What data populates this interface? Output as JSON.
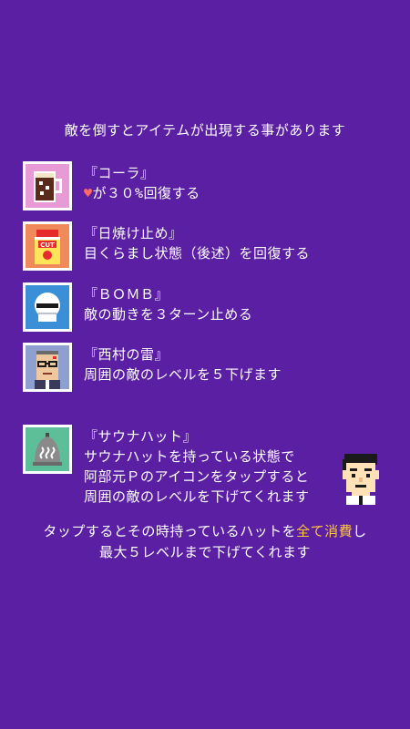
{
  "intro": "敵を倒すとアイテムが出現する事があります",
  "items": [
    {
      "icon": "cola-mug-icon",
      "title": "『コーラ』",
      "desc_prefix": "♥",
      "desc": "が３０%回復する"
    },
    {
      "icon": "sunscreen-bottle-icon",
      "title": "『日焼け止め』",
      "desc": "目くらまし状態（後述）を回復する",
      "label": "CUT"
    },
    {
      "icon": "bomb-icon",
      "title": "『ＢＯＭＢ』",
      "desc": "敵の動きを３ターン止める"
    },
    {
      "icon": "nishimura-face-icon",
      "title": "『西村の雷』",
      "desc": "周囲の敵のレベルを５下げます"
    },
    {
      "icon": "sauna-hat-icon",
      "title": "『サウナハット』",
      "desc1": "サウナハットを持っている状態で",
      "desc2": "阿部元Ｐのアイコンをタップすると",
      "desc3": "周囲の敵のレベルを下げてくれます"
    }
  ],
  "outro": {
    "line1_a": "タップするとその時持っているハットを",
    "line1_hl": "全て消費",
    "line1_b": "し",
    "line2": "最大５レベルまで下げてくれます"
  },
  "colors": {
    "background": "#5b1fa3",
    "highlight": "#ffc83a",
    "heart": "#ff6b63"
  }
}
